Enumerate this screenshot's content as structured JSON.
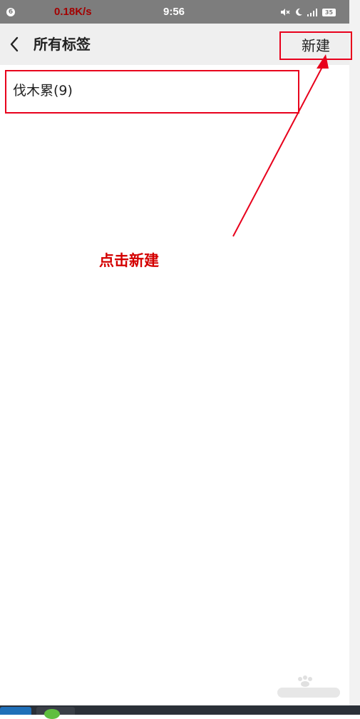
{
  "status_bar": {
    "badge": "6",
    "net_speed": "0.18K/s",
    "time": "9:56",
    "battery": "35",
    "icons": [
      "mute-icon",
      "moon-icon",
      "signal-icon",
      "battery-icon"
    ]
  },
  "header": {
    "back_icon": "chevron-left-icon",
    "title": "所有标签",
    "new_button": "新建"
  },
  "tags": [
    {
      "label": "伐木累(9)"
    }
  ],
  "annotation": {
    "text": "点击新建",
    "color": "#e8001c"
  },
  "watermark": {
    "logo": "baidu-jingyan-logo"
  }
}
